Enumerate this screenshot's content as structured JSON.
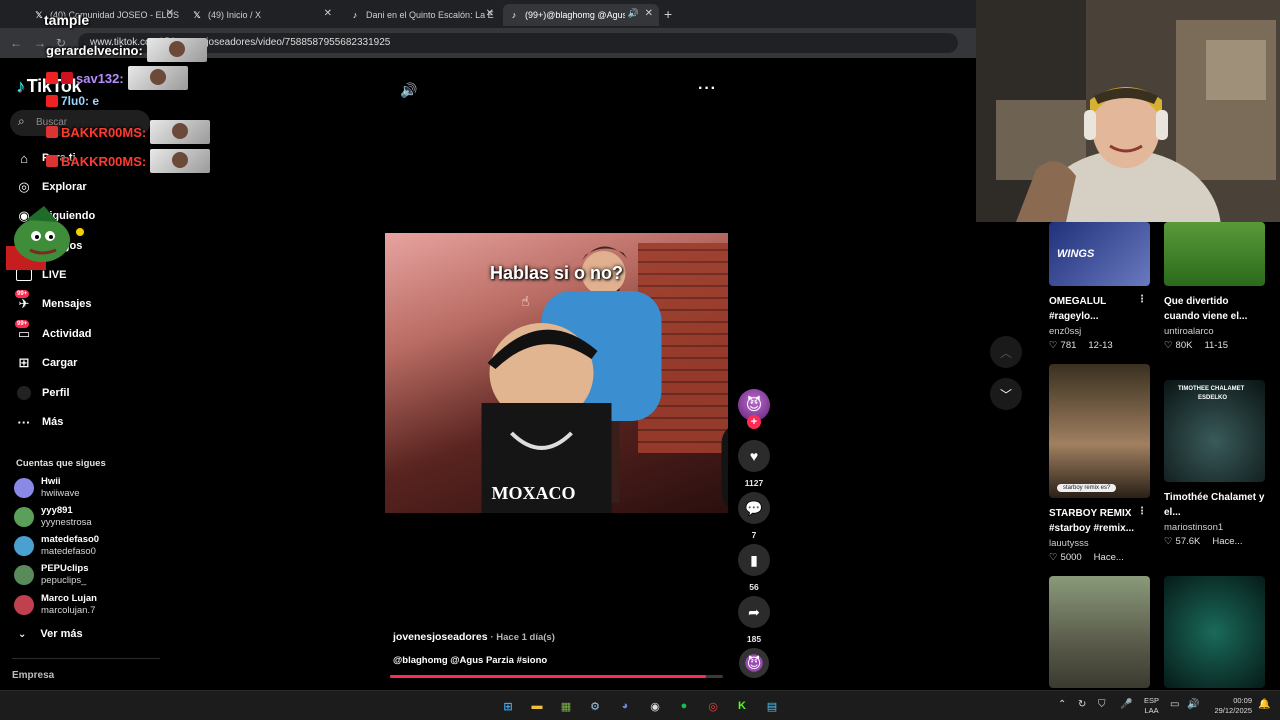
{
  "browser": {
    "tabs": [
      {
        "title": "(40) Comunidad JOSEO - ELUS",
        "icon": "x-icon"
      },
      {
        "title": "(49) Inicio / X",
        "icon": "x-icon"
      },
      {
        "title": "Dani en el Quinto Escalón: La E",
        "icon": "tiktok-icon"
      },
      {
        "title": "(99+)@blaghomg @Agus P",
        "icon": "tiktok-icon"
      }
    ],
    "url": "www.tiktok.com/@jovenesjoseadores/video/7588587955682331925"
  },
  "chat": {
    "lines": [
      {
        "user": "gerardelvecino:",
        "color": "#ffffff"
      },
      {
        "user": "sav132:",
        "color": "#b58cff"
      },
      {
        "user": "7lu0: e",
        "color": "#9ad6ff"
      },
      {
        "user": "BAKKR00MS:",
        "color": "#ff3b30"
      },
      {
        "user": "BAKKR00MS:",
        "color": "#ff3b30"
      },
      {
        "user": "tample",
        "color": "#ffffff"
      }
    ]
  },
  "sidebar": {
    "logo": "TikTok",
    "search_placeholder": "Buscar",
    "nav": [
      {
        "label": "Para ti",
        "icon": "home-icon"
      },
      {
        "label": "Explorar",
        "icon": "compass-icon"
      },
      {
        "label": "Siguiendo",
        "icon": "following-icon"
      },
      {
        "label": "Amigos",
        "icon": "friends-icon"
      },
      {
        "label": "LIVE",
        "icon": "live-icon"
      },
      {
        "label": "Mensajes",
        "icon": "messages-icon",
        "badge": "99+"
      },
      {
        "label": "Actividad",
        "icon": "activity-icon",
        "badge": "99+"
      },
      {
        "label": "Cargar",
        "icon": "upload-icon"
      },
      {
        "label": "Perfil",
        "icon": "profile-icon"
      },
      {
        "label": "Más",
        "icon": "more-icon"
      }
    ],
    "following_title": "Cuentas que sigues",
    "following": [
      {
        "name": "Hwii",
        "handle": "hwiiwave",
        "color": "#8a8ae6"
      },
      {
        "name": "yyy891",
        "handle": "yyynestrosa",
        "color": "#5aa05a"
      },
      {
        "name": "matedefaso0",
        "handle": "matedefaso0",
        "color": "#4aa0d0"
      },
      {
        "name": "PEPUclips",
        "handle": "pepuclips_",
        "color": "#5a8a5a"
      },
      {
        "name": "Marco Lujan",
        "handle": "marcolujan.7",
        "color": "#c04050"
      }
    ],
    "see_more": "Ver más",
    "footer": "Empresa"
  },
  "video": {
    "overlay_text": "Hablas si o no?",
    "author": "jovenesjoseadores",
    "time": "· Hace 1 día(s)",
    "description": "@blaghomg @Agus Parzia #siono",
    "progress": 0.95,
    "likes": "1127",
    "comments": "7",
    "saves": "56",
    "shares": "185"
  },
  "recommendations": [
    {
      "title": "OMEGALUL #rageylo...",
      "author": "enz0ssj",
      "likes": "781",
      "date": "12-13",
      "thumb": "#2a3a8a"
    },
    {
      "title": "Que divertido cuando viene el...",
      "author": "untiroalarco",
      "likes": "80K",
      "date": "11-15",
      "thumb": "#3a7a2a"
    },
    {
      "title": "STARBOY REMIX #starboy #remix...",
      "author": "lauutysss",
      "likes": "5000",
      "date": "Hace...",
      "thumb": "#5a4a3a"
    },
    {
      "title": "Timothée Chalamet y el...",
      "author": "mariostinson1",
      "likes": "57.6K",
      "date": "Hace...",
      "thumb": "#1a2a2a"
    },
    {
      "title": "",
      "author": "",
      "likes": "",
      "date": "",
      "thumb": "#6a6a5a"
    },
    {
      "title": "",
      "author": "",
      "likes": "",
      "date": "",
      "thumb": "#0a3a3a"
    }
  ],
  "thumb_text": {
    "starboy": "starboy remix es?",
    "timothee": "TIMOTHEE CHALAMET",
    "timothee2": "ESDELKO"
  },
  "taskbar": {
    "lang": [
      "ESP",
      "LAA"
    ],
    "time": "00:09",
    "date": "29/12/2025"
  }
}
